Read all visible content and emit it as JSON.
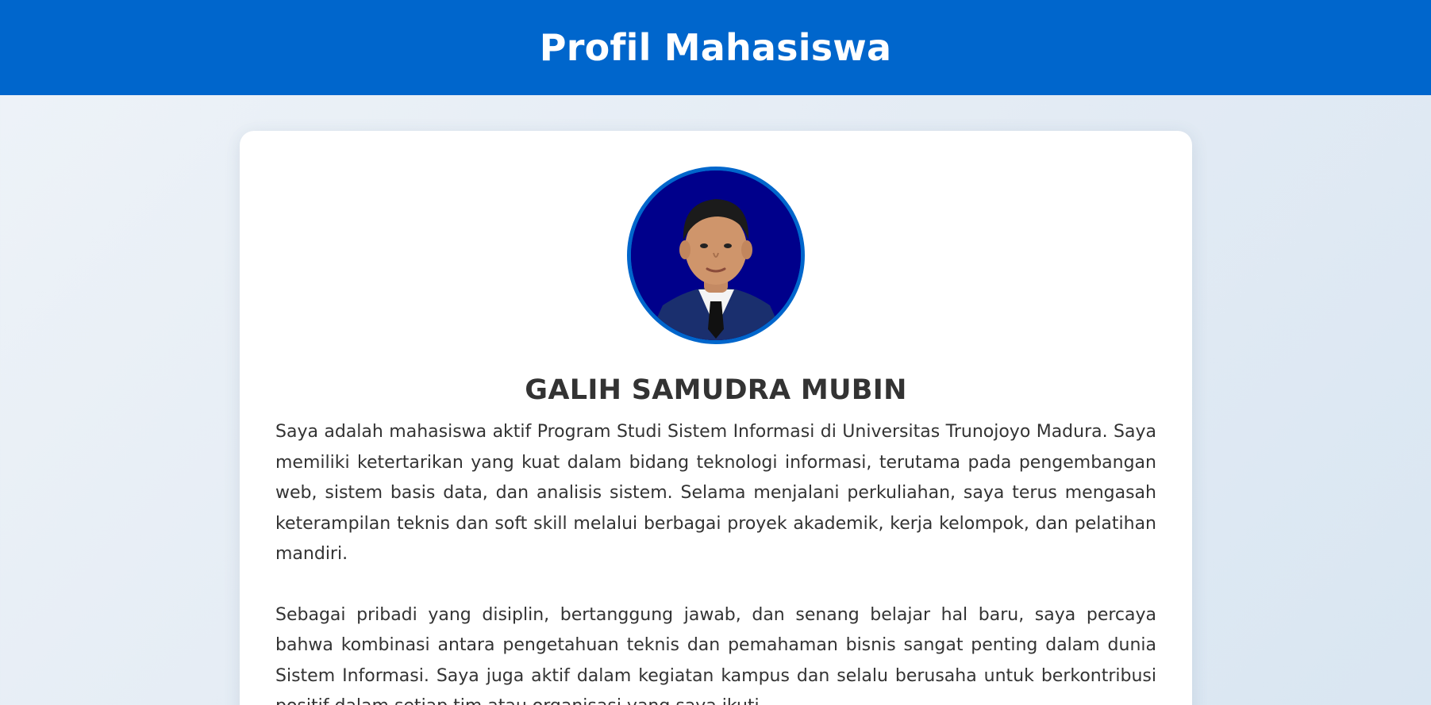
{
  "header": {
    "title": "Profil Mahasiswa",
    "background_color": "#0066cc"
  },
  "profile": {
    "photo_icon": "student-portrait-photo",
    "photo_border_color": "#0066cc",
    "name": "GALIH SAMUDRA MUBIN",
    "bio": [
      "Saya adalah mahasiswa aktif Program Studi Sistem Informasi di Universitas Trunojoyo Madura. Saya memiliki ketertarikan yang kuat dalam bidang teknologi informasi, terutama pada pengembangan web, sistem basis data, dan analisis sistem. Selama menjalani perkuliahan, saya terus mengasah keterampilan teknis dan soft skill melalui berbagai proyek akademik, kerja kelompok, dan pelatihan mandiri.",
      "Sebagai pribadi yang disiplin, bertanggung jawab, dan senang belajar hal baru, saya percaya bahwa kombinasi antara pengetahuan teknis dan pemahaman bisnis sangat penting dalam dunia Sistem Informasi. Saya juga aktif dalam kegiatan kampus dan selalu berusaha untuk berkontribusi positif dalam setiap tim atau organisasi yang saya ikuti."
    ]
  }
}
